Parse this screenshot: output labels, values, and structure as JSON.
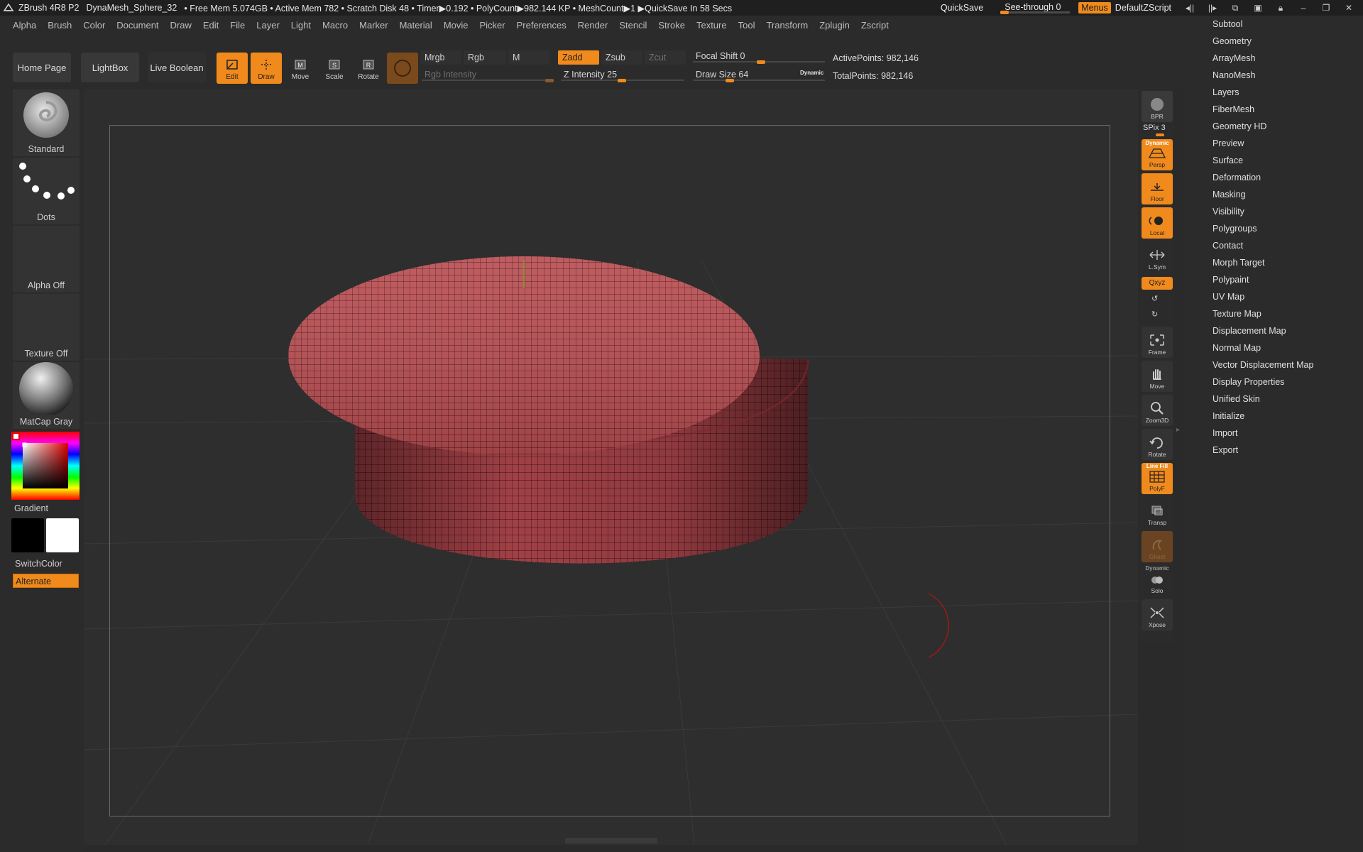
{
  "titlebar": {
    "app": "ZBrush 4R8 P2",
    "document": "DynaMesh_Sphere_32",
    "status": "• Free Mem 5.074GB • Active Mem 782 • Scratch Disk 48 •  Timer▶0.192 • PolyCount▶982.144 KP • MeshCount▶1  ▶QuickSave In 58 Secs",
    "quicksave": "QuickSave",
    "seethrough": "See-through  0",
    "menus": "Menus",
    "default_zscript": "DefaultZScript"
  },
  "menubar": [
    "Alpha",
    "Brush",
    "Color",
    "Document",
    "Draw",
    "Edit",
    "File",
    "Layer",
    "Light",
    "Macro",
    "Marker",
    "Material",
    "Movie",
    "Picker",
    "Preferences",
    "Render",
    "Stencil",
    "Stroke",
    "Texture",
    "Tool",
    "Transform",
    "Zplugin",
    "Zscript"
  ],
  "toolbar": {
    "home_page": "Home Page",
    "lightbox": "LightBox",
    "live_boolean": "Live Boolean",
    "edit": "Edit",
    "draw": "Draw",
    "move": "Move",
    "scale": "Scale",
    "rotate": "Rotate",
    "mrgb": "Mrgb",
    "rgb": "Rgb",
    "m": "M",
    "zadd": "Zadd",
    "zsub": "Zsub",
    "zcut": "Zcut",
    "rgb_intensity": "Rgb Intensity",
    "z_intensity": "Z Intensity 25",
    "focal_shift": "Focal Shift 0",
    "draw_size": "Draw Size 64",
    "dynamic": "Dynamic",
    "active_points": "ActivePoints: 982,146",
    "total_points": "TotalPoints: 982,146"
  },
  "sliders": {
    "see_through": 0,
    "z_intensity": 25,
    "focal_shift": 0,
    "draw_size": 64
  },
  "leftshelf": {
    "brush": "Standard",
    "stroke": "Dots",
    "alpha": "Alpha Off",
    "texture": "Texture Off",
    "material": "MatCap Gray",
    "gradient": "Gradient",
    "switch_color": "SwitchColor",
    "alternate": "Alternate"
  },
  "rightshelf": {
    "bpr": "BPR",
    "spix": "SPix 3",
    "dynamic": "Dynamic",
    "persp": "Persp",
    "floor": "Floor",
    "local": "Local",
    "lsym": "L.Sym",
    "xyz": "Qxyz",
    "frame": "Frame",
    "move": "Move",
    "zoom3d": "Zoom3D",
    "rotate": "Rotate",
    "line_fill": "Line Fill",
    "polyf": "PolyF",
    "transp": "Transp",
    "ghost": "Ghost",
    "dynamic2": "Dynamic",
    "solo": "Solo",
    "xpose": "Xpose"
  },
  "tray": [
    "Subtool",
    "Geometry",
    "ArrayMesh",
    "NanoMesh",
    "Layers",
    "FiberMesh",
    "Geometry HD",
    "Preview",
    "Surface",
    "Deformation",
    "Masking",
    "Visibility",
    "Polygroups",
    "Contact",
    "Morph Target",
    "Polypaint",
    "UV Map",
    "Texture Map",
    "Displacement Map",
    "Normal Map",
    "Vector Displacement Map",
    "Display Properties",
    "Unified Skin",
    "Initialize",
    "Import",
    "Export"
  ],
  "colors": {
    "accent": "#f08a1c",
    "mesh": "#b94e52",
    "panel": "#2b2b2b",
    "viewport": "#2e2e2e"
  }
}
